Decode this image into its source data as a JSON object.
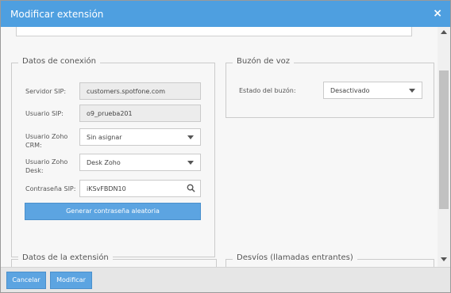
{
  "dialog": {
    "title": "Modificar extensión",
    "close_icon": "×"
  },
  "conexion": {
    "legend": "Datos de conexión",
    "servidor_label": "Servidor SIP:",
    "servidor_value": "customers.spotfone.com",
    "usuario_label": "Usuario SIP:",
    "usuario_value": "o9_prueba201",
    "crm_label": "Usuario Zoho CRM:",
    "crm_value": "Sin asignar",
    "desk_label": "Usuario Zoho Desk:",
    "desk_value": "Desk Zoho",
    "password_label": "Contraseña SIP:",
    "password_value": "iKSvFBDN10",
    "generate_label": "Generar contraseña aleatoria"
  },
  "buzon": {
    "legend": "Buzón de voz",
    "estado_label": "Estado del buzón:",
    "estado_value": "Desactivado"
  },
  "extension": {
    "legend": "Datos de la extensión"
  },
  "desvios": {
    "legend": "Desvíos (llamadas entrantes)"
  },
  "footer": {
    "cancel_label": "Cancelar",
    "modify_label": "Modificar"
  },
  "icons": {
    "close": "close-icon",
    "search": "search-icon",
    "dropdown": "chevron-down-icon"
  },
  "colors": {
    "accent": "#4e9fe0",
    "button": "#5ca4e1"
  }
}
